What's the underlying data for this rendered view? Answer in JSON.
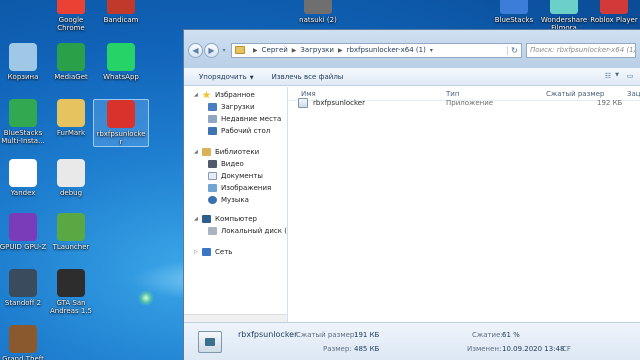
{
  "desktop": {
    "icons": [
      {
        "id": "google-chrome",
        "label": "Google\nChrome",
        "color": "#e94235"
      },
      {
        "id": "bandicam",
        "label": "Bandicam",
        "color": "#c0392b"
      },
      {
        "id": "recycle-bin",
        "label": "Корзина",
        "color": "#9fc7e6"
      },
      {
        "id": "mediaget",
        "label": "MediaGet",
        "color": "#2aa04a"
      },
      {
        "id": "whatsapp",
        "label": "WhatsApp",
        "color": "#25d366"
      },
      {
        "id": "bluestacks-multi",
        "label": "BlueStacks\nMulti-Insta...",
        "color": "#33a852"
      },
      {
        "id": "furmark",
        "label": "FurMark",
        "color": "#e6c35e"
      },
      {
        "id": "rbxfpsunlocker",
        "label": "rbxfpsunlocke\nr",
        "color": "#d9312b"
      },
      {
        "id": "yandex",
        "label": "Yandex",
        "color": "#ffffff"
      },
      {
        "id": "debug",
        "label": "debug",
        "color": "#e9e9e9"
      },
      {
        "id": "gpuid",
        "label": "GPUID GPU-Z",
        "color": "#7a3cb8"
      },
      {
        "id": "tlauncher",
        "label": "TLauncher",
        "color": "#5aa844"
      },
      {
        "id": "standoff2",
        "label": "Standoff 2",
        "color": "#3b4b5e"
      },
      {
        "id": "gta-sa",
        "label": "GTA San\nAndreas 1.5",
        "color": "#2d2d2d"
      },
      {
        "id": "grand-theft",
        "label": "Grand Theft",
        "color": "#8a5a2e"
      },
      {
        "id": "natsuki",
        "label": "natsuki (2)",
        "color": "#6f6f6f"
      },
      {
        "id": "bluestacks",
        "label": "BlueStacks",
        "color": "#3b7dd8"
      },
      {
        "id": "wondershare",
        "label": "Wondershare\nFilmora",
        "color": "#6bd1c8"
      },
      {
        "id": "roblox-player",
        "label": "Roblox Player",
        "color": "#d23a3a"
      }
    ]
  },
  "explorer": {
    "breadcrumb": [
      "Сергей",
      "Загрузки",
      "rbxfpsunlocker-x64 (1)"
    ],
    "search_placeholder": "Поиск: rbxfpsunlocker-x64 (1)",
    "commands": {
      "organize": "Упорядочить",
      "extract": "Извлечь все файлы"
    },
    "nav": {
      "favorites": "Избранное",
      "downloads": "Загрузки",
      "recent": "Недавние места",
      "desktop": "Рабочий стол",
      "libraries": "Библиотеки",
      "video": "Видео",
      "documents": "Документы",
      "images": "Изображения",
      "music": "Музыка",
      "computer": "Компьютер",
      "local_disk": "Локальный диск (C",
      "network": "Сеть"
    },
    "columns": {
      "name": "Имя",
      "type": "Тип",
      "compressed": "Сжатый размер",
      "extra": "Зац"
    },
    "files": [
      {
        "name": "rbxfpsunlocker",
        "type": "Приложение",
        "compressed": "192 КБ"
      }
    ],
    "status": {
      "file_name": "rbxfpsunlocker",
      "compressed_label": "Сжатый размер:",
      "compressed_value": "191 КБ",
      "size_label": "Размер:",
      "size_value": "485 КБ",
      "ratio_label": "Сжатие:",
      "ratio_value": "61 %",
      "date_label": "Изменен:",
      "date_value": "10.09.2020 13:48",
      "trailing": "CF"
    }
  }
}
